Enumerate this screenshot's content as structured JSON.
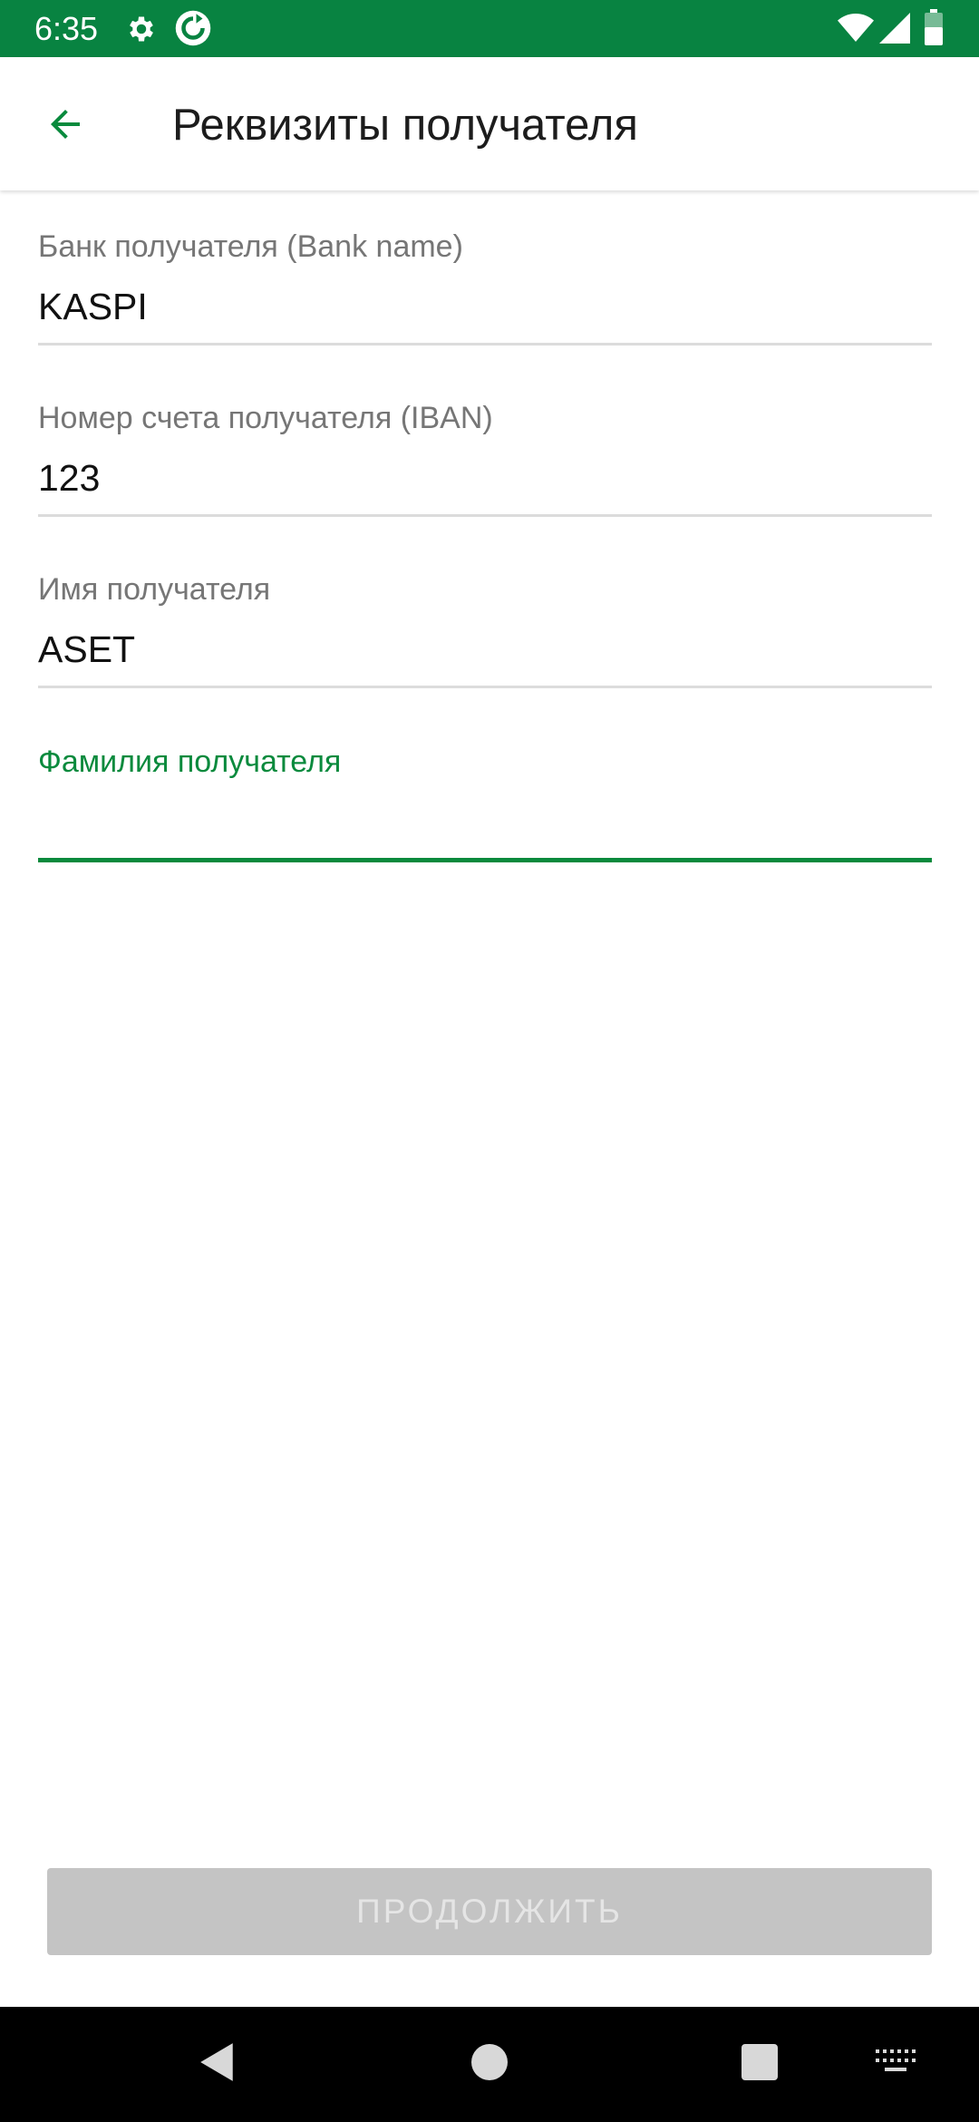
{
  "status_bar": {
    "time": "6:35",
    "icons": [
      "gear-icon",
      "sync-icon",
      "wifi-icon",
      "signal-icon",
      "battery-icon"
    ],
    "background": "#088341"
  },
  "app_bar": {
    "back_icon": "arrow-left-icon",
    "title": "Реквизиты получателя"
  },
  "form": {
    "fields": [
      {
        "label": "Банк получателя (Bank name)",
        "value": "KASPI"
      },
      {
        "label": "Номер счета получателя (IBAN)",
        "value": "123"
      },
      {
        "label": "Имя получателя",
        "value": "ASET"
      },
      {
        "label": "Фамилия получателя",
        "value": "",
        "focused": true
      }
    ]
  },
  "continue_button": {
    "label": "ПРОДОЛЖИТЬ",
    "enabled": false
  },
  "nav_bar": {
    "icons": [
      "back-triangle-icon",
      "home-circle-icon",
      "recents-square-icon",
      "keyboard-icon"
    ]
  },
  "colors": {
    "accent": "#098a3d",
    "button_disabled": "#c4c4c4"
  }
}
